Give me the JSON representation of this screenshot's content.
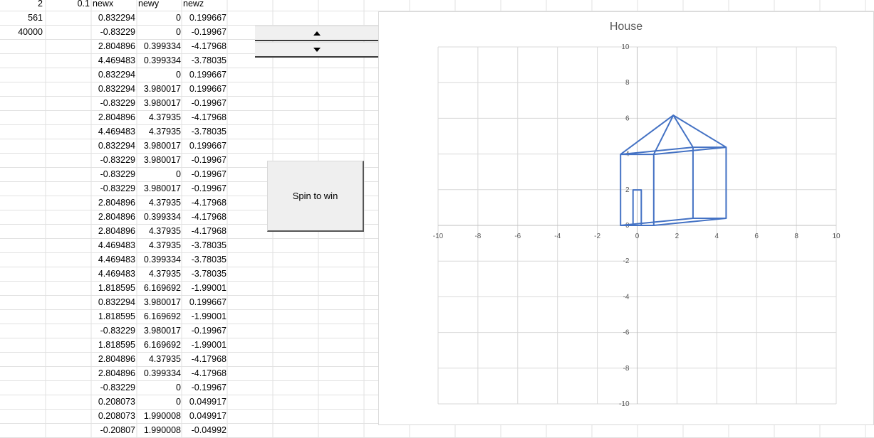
{
  "sheet": {
    "a1": "2",
    "a2": "561",
    "a3": "40000",
    "b1": "0.1",
    "headers": [
      "newx",
      "newy",
      "newz"
    ],
    "rows": [
      [
        "0.832294",
        "0",
        "0.199667"
      ],
      [
        "-0.83229",
        "0",
        "-0.19967"
      ],
      [
        "2.804896",
        "0.399334",
        "-4.17968"
      ],
      [
        "4.469483",
        "0.399334",
        "-3.78035"
      ],
      [
        "0.832294",
        "0",
        "0.199667"
      ],
      [
        "0.832294",
        "3.980017",
        "0.199667"
      ],
      [
        "-0.83229",
        "3.980017",
        "-0.19967"
      ],
      [
        "2.804896",
        "4.37935",
        "-4.17968"
      ],
      [
        "4.469483",
        "4.37935",
        "-3.78035"
      ],
      [
        "0.832294",
        "3.980017",
        "0.199667"
      ],
      [
        "-0.83229",
        "3.980017",
        "-0.19967"
      ],
      [
        "-0.83229",
        "0",
        "-0.19967"
      ],
      [
        "-0.83229",
        "3.980017",
        "-0.19967"
      ],
      [
        "2.804896",
        "4.37935",
        "-4.17968"
      ],
      [
        "2.804896",
        "0.399334",
        "-4.17968"
      ],
      [
        "2.804896",
        "4.37935",
        "-4.17968"
      ],
      [
        "4.469483",
        "4.37935",
        "-3.78035"
      ],
      [
        "4.469483",
        "0.399334",
        "-3.78035"
      ],
      [
        "4.469483",
        "4.37935",
        "-3.78035"
      ],
      [
        "1.818595",
        "6.169692",
        "-1.99001"
      ],
      [
        "0.832294",
        "3.980017",
        "0.199667"
      ],
      [
        "1.818595",
        "6.169692",
        "-1.99001"
      ],
      [
        "-0.83229",
        "3.980017",
        "-0.19967"
      ],
      [
        "1.818595",
        "6.169692",
        "-1.99001"
      ],
      [
        "2.804896",
        "4.37935",
        "-4.17968"
      ],
      [
        "2.804896",
        "0.399334",
        "-4.17968"
      ],
      [
        "-0.83229",
        "0",
        "-0.19967"
      ],
      [
        "0.208073",
        "0",
        "0.049917"
      ],
      [
        "0.208073",
        "1.990008",
        "0.049917"
      ],
      [
        "-0.20807",
        "1.990008",
        "-0.04992"
      ]
    ]
  },
  "controls": {
    "spin_up_icon": "triangle-up-icon",
    "spin_down_icon": "triangle-down-icon",
    "spin_button_label": "Spin to win"
  },
  "chart_data": {
    "type": "scatter",
    "title": "House",
    "xlabel": "",
    "ylabel": "",
    "xlim": [
      -10,
      10
    ],
    "ylim": [
      -10,
      10
    ],
    "x_ticks": [
      "-10",
      "-8",
      "-6",
      "-4",
      "-2",
      "0",
      "2",
      "4",
      "6",
      "8",
      "10"
    ],
    "y_ticks": [
      "10",
      "8",
      "6",
      "4",
      "2",
      "0",
      "-2",
      "-4",
      "-6",
      "-8",
      "-10"
    ],
    "grid": true,
    "series_color": "#4472c4",
    "series": [
      {
        "x": [
          0.832294,
          -0.83229,
          2.804896,
          4.469483,
          0.832294,
          0.832294,
          -0.83229,
          2.804896,
          4.469483,
          0.832294,
          -0.83229,
          -0.83229,
          -0.83229,
          2.804896,
          2.804896,
          2.804896,
          4.469483,
          4.469483,
          4.469483,
          1.818595,
          0.832294,
          1.818595,
          -0.83229,
          1.818595,
          2.804896,
          2.804896,
          -0.83229,
          0.208073,
          0.208073,
          -0.20807,
          -0.20807
        ],
        "y": [
          0,
          0,
          0.399334,
          0.399334,
          0,
          3.980017,
          3.980017,
          4.37935,
          4.37935,
          3.980017,
          3.980017,
          0,
          3.980017,
          4.37935,
          0.399334,
          4.37935,
          4.37935,
          0.399334,
          4.37935,
          6.169692,
          3.980017,
          6.169692,
          3.980017,
          6.169692,
          4.37935,
          0.399334,
          0,
          0,
          1.990008,
          1.990008,
          0
        ]
      }
    ]
  }
}
